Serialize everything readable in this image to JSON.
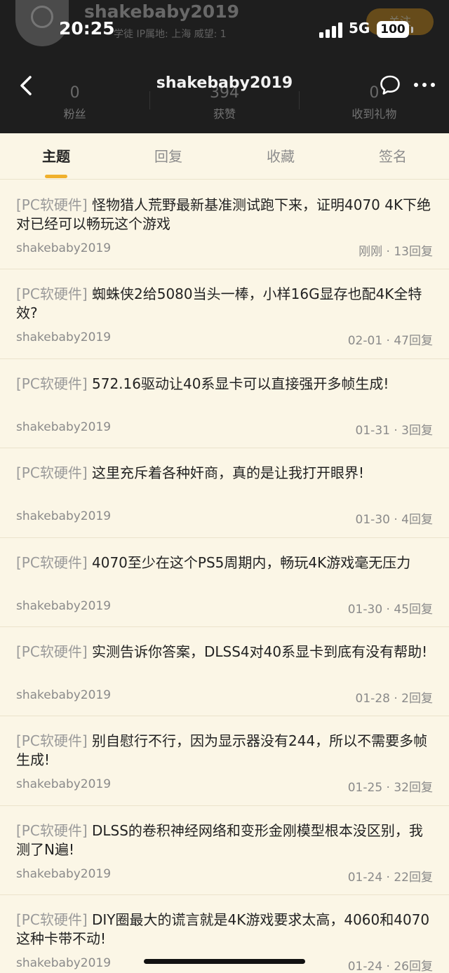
{
  "status_bar": {
    "time": "20:25",
    "network": "5G",
    "battery": "100"
  },
  "profile_bg": {
    "username": "shakebaby2019",
    "meta": "学徒  IP属地: 上海  威望: 1",
    "follow_label": "关注",
    "stats": [
      {
        "value": "0",
        "label": "粉丝"
      },
      {
        "value": "394",
        "label": "获赞"
      },
      {
        "value": "0",
        "label": "收到礼物"
      }
    ]
  },
  "nav": {
    "title": "shakebaby2019"
  },
  "tabs": [
    {
      "label": "主题",
      "active": true
    },
    {
      "label": "回复",
      "active": false
    },
    {
      "label": "收藏",
      "active": false
    },
    {
      "label": "签名",
      "active": false
    }
  ],
  "posts": [
    {
      "tag": "[PC软硬件]",
      "title": "怪物猎人荒野最新基准测试跑下来，证明4070 4K下绝对已经可以畅玩这个游戏",
      "author": "shakebaby2019",
      "date": "刚刚",
      "replies": "13回复"
    },
    {
      "tag": "[PC软硬件]",
      "title": "蜘蛛侠2给5080当头一棒，小样16G显存也配4K全特效?",
      "author": "shakebaby2019",
      "date": "02-01",
      "replies": "47回复"
    },
    {
      "tag": "[PC软硬件]",
      "title": "572.16驱动让40系显卡可以直接强开多帧生成!",
      "author": "shakebaby2019",
      "date": "01-31",
      "replies": "3回复"
    },
    {
      "tag": "[PC软硬件]",
      "title": "这里充斥着各种奸商，真的是让我打开眼界!",
      "author": "shakebaby2019",
      "date": "01-30",
      "replies": "4回复"
    },
    {
      "tag": "[PC软硬件]",
      "title": "4070至少在这个PS5周期内，畅玩4K游戏毫无压力",
      "author": "shakebaby2019",
      "date": "01-30",
      "replies": "45回复"
    },
    {
      "tag": "[PC软硬件]",
      "title": "实测告诉你答案，DLSS4对40系显卡到底有没有帮助!",
      "author": "shakebaby2019",
      "date": "01-28",
      "replies": "2回复"
    },
    {
      "tag": "[PC软硬件]",
      "title": "别自慰行不行，因为显示器没有244，所以不需要多帧生成!",
      "author": "shakebaby2019",
      "date": "01-25",
      "replies": "32回复"
    },
    {
      "tag": "[PC软硬件]",
      "title": "DLSS的卷积神经网络和变形金刚模型根本没区别，我测了N遍!",
      "author": "shakebaby2019",
      "date": "01-24",
      "replies": "22回复"
    },
    {
      "tag": "[PC软硬件]",
      "title": "DIY圈最大的谎言就是4K游戏要求太高，4060和4070这种卡带不动!",
      "author": "shakebaby2019",
      "date": "01-24",
      "replies": "26回复"
    }
  ]
}
